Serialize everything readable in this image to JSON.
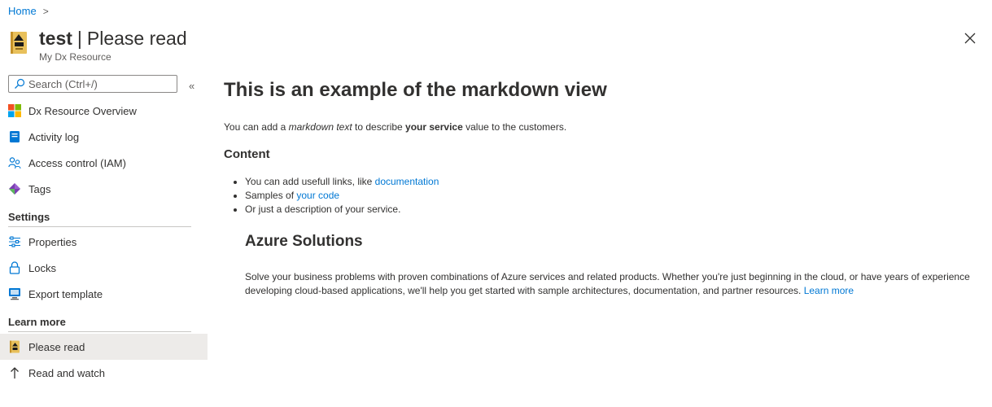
{
  "breadcrumb": {
    "home": "Home",
    "separator": ">"
  },
  "header": {
    "name": "test",
    "divider": "|",
    "page": "Please read",
    "subtitle": "My Dx Resource"
  },
  "search": {
    "placeholder": "Search (Ctrl+/)",
    "collapse": "«"
  },
  "nav": {
    "main": [
      {
        "label": "Dx Resource Overview",
        "icon": "windows-grid-icon"
      },
      {
        "label": "Activity log",
        "icon": "activity-log-icon"
      },
      {
        "label": "Access control (IAM)",
        "icon": "people-icon"
      },
      {
        "label": "Tags",
        "icon": "tag-icon"
      }
    ],
    "settings_title": "Settings",
    "settings": [
      {
        "label": "Properties",
        "icon": "sliders-icon"
      },
      {
        "label": "Locks",
        "icon": "lock-icon"
      },
      {
        "label": "Export template",
        "icon": "export-icon"
      }
    ],
    "learn_title": "Learn more",
    "learn": [
      {
        "label": "Please read",
        "icon": "book-icon",
        "selected": true
      },
      {
        "label": "Read and watch",
        "icon": "arrow-up-icon"
      }
    ]
  },
  "content": {
    "heading": "This is an example of the markdown view",
    "intro_pre": "You can add a ",
    "intro_em": "markdown text",
    "intro_mid": " to describe ",
    "intro_bold": "your service",
    "intro_post": " value to the customers.",
    "subheading": "Content",
    "bullets": {
      "b1_text": "You can add usefull links, like ",
      "b1_link": "documentation",
      "b2_text": "Samples of ",
      "b2_link": "your code",
      "b3_text": "Or just a description of your service."
    },
    "azure": {
      "title": "Azure Solutions",
      "body": "Solve your business problems with proven combinations of Azure services and related products. Whether you're just beginning in the cloud, or have years of experience developing cloud-based applications, we'll help you get started with sample architectures, documentation, and partner resources. ",
      "link": "Learn more"
    }
  },
  "colors": {
    "link": "#0078d4",
    "selected_bg": "#edebe9",
    "text": "#323130"
  }
}
